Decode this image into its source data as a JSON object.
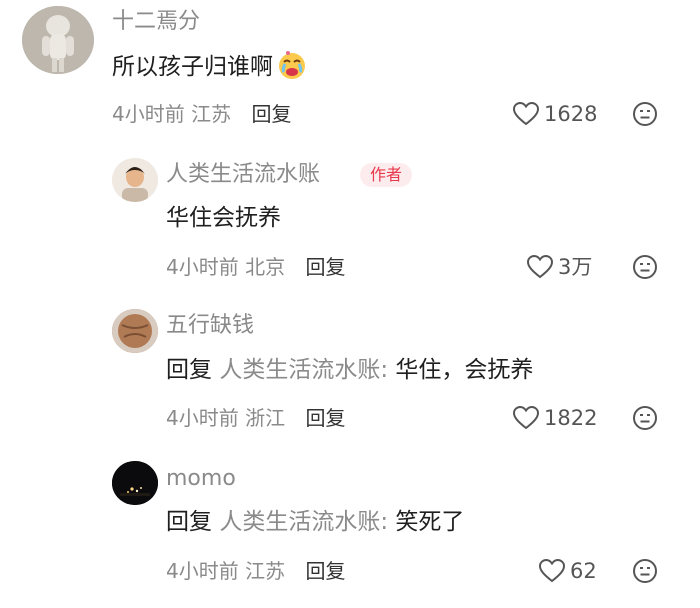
{
  "comments": [
    {
      "user": "十二焉分",
      "text": "所以孩子归谁啊",
      "emoji": "crying-face-emoji",
      "time": "4小时前",
      "location": "江苏",
      "reply_label": "回复",
      "likes": "1628"
    },
    {
      "user": "人类生活流水账",
      "badge": "作者",
      "text": "华住会抚养",
      "time": "4小时前",
      "location": "北京",
      "reply_label": "回复",
      "likes": "3万"
    },
    {
      "user": "五行缺钱",
      "reply_word": "回复",
      "reply_target": "人类生活流水账:",
      "text": "华住，会抚养",
      "time": "4小时前",
      "location": "浙江",
      "reply_label": "回复",
      "likes": "1822"
    },
    {
      "user": "momo",
      "reply_word": "回复",
      "reply_target": "人类生活流水账:",
      "text": "笑死了",
      "time": "4小时前",
      "location": "江苏",
      "reply_label": "回复",
      "likes": "62"
    }
  ],
  "colors": {
    "name": "#8a8a8a",
    "text": "#1f1f1f",
    "badge_text": "#e8394b",
    "badge_bg": "#fdecee"
  }
}
